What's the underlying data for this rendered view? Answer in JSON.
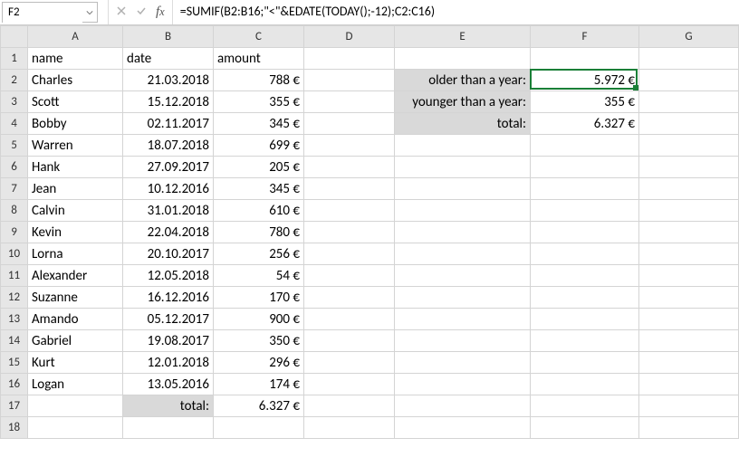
{
  "name_box": "F2",
  "formula": "=SUMIF(B2:B16;\"<\"&EDATE(TODAY();-12);C2:C16)",
  "columns": [
    "A",
    "B",
    "C",
    "D",
    "E",
    "F",
    "G"
  ],
  "row_count": 18,
  "headers": {
    "A": "name",
    "B": "date",
    "C": "amount"
  },
  "rows": [
    {
      "name": "Charles",
      "date": "21.03.2018",
      "amount": "788 €"
    },
    {
      "name": "Scott",
      "date": "15.12.2018",
      "amount": "355 €"
    },
    {
      "name": "Bobby",
      "date": "02.11.2017",
      "amount": "345 €"
    },
    {
      "name": "Warren",
      "date": "18.07.2018",
      "amount": "699 €"
    },
    {
      "name": "Hank",
      "date": "27.09.2017",
      "amount": "205 €"
    },
    {
      "name": "Jean",
      "date": "10.12.2016",
      "amount": "345 €"
    },
    {
      "name": "Calvin",
      "date": "31.01.2018",
      "amount": "610 €"
    },
    {
      "name": "Kevin",
      "date": "22.04.2018",
      "amount": "780 €"
    },
    {
      "name": "Lorna",
      "date": "20.10.2017",
      "amount": "256 €"
    },
    {
      "name": "Alexander",
      "date": "12.05.2018",
      "amount": "54 €"
    },
    {
      "name": "Suzanne",
      "date": "16.12.2016",
      "amount": "170 €"
    },
    {
      "name": "Amando",
      "date": "05.12.2017",
      "amount": "900 €"
    },
    {
      "name": "Gabriel",
      "date": "19.08.2017",
      "amount": "350 €"
    },
    {
      "name": "Kurt",
      "date": "12.01.2018",
      "amount": "296 €"
    },
    {
      "name": "Logan",
      "date": "13.05.2016",
      "amount": "174 €"
    }
  ],
  "total_row": {
    "label": "total:",
    "value": "6.327 €"
  },
  "summary": {
    "older_label": "older than a year:",
    "older_value": "5.972 €",
    "younger_label": "younger than a year:",
    "younger_value": "355 €",
    "total_label": "total:",
    "total_value": "6.327 €"
  },
  "active_cell": "F2",
  "chart_data": {
    "type": "table",
    "columns": [
      "name",
      "date",
      "amount_eur"
    ],
    "records": [
      [
        "Charles",
        "21.03.2018",
        788
      ],
      [
        "Scott",
        "15.12.2018",
        355
      ],
      [
        "Bobby",
        "02.11.2017",
        345
      ],
      [
        "Warren",
        "18.07.2018",
        699
      ],
      [
        "Hank",
        "27.09.2017",
        205
      ],
      [
        "Jean",
        "10.12.2016",
        345
      ],
      [
        "Calvin",
        "31.01.2018",
        610
      ],
      [
        "Kevin",
        "22.04.2018",
        780
      ],
      [
        "Lorna",
        "20.10.2017",
        256
      ],
      [
        "Alexander",
        "12.05.2018",
        54
      ],
      [
        "Suzanne",
        "16.12.2016",
        170
      ],
      [
        "Amando",
        "05.12.2017",
        900
      ],
      [
        "Gabriel",
        "19.08.2017",
        350
      ],
      [
        "Kurt",
        "12.01.2018",
        296
      ],
      [
        "Logan",
        "13.05.2016",
        174
      ]
    ],
    "aggregates": {
      "older_than_a_year": 5972,
      "younger_than_a_year": 355,
      "total": 6327
    }
  }
}
